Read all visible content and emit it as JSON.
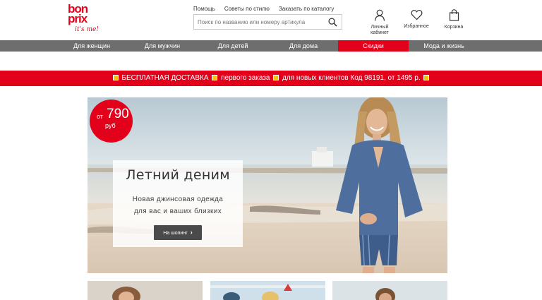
{
  "brand": {
    "logo_line1": "bon",
    "logo_line2": "prix",
    "tagline": "it's me!"
  },
  "top_links": [
    "Помощь",
    "Советы по стилю",
    "Заказать по каталогу"
  ],
  "search": {
    "placeholder": "Поиск по названию или номеру артикула",
    "icon": "search-icon"
  },
  "user_icons": [
    {
      "label_line1": "Личный",
      "label_line2": "кабинет",
      "icon": "user-icon"
    },
    {
      "label": "Избранное",
      "icon": "heart-icon"
    },
    {
      "label": "Корзина",
      "icon": "shopping-bag-icon"
    }
  ],
  "nav": [
    "Для женщин",
    "Для мужчин",
    "Для детей",
    "Для дома",
    "Скидки",
    "Мода и жизнь"
  ],
  "promo": {
    "part1": "БЕСПЛАТНАЯ ДОСТАВКА",
    "part2": "первого заказа",
    "part3": "для новых клиентов",
    "part4": "Код 98191, от 1495 р."
  },
  "hero": {
    "price_from": "от",
    "price_value": "790",
    "price_currency": "руб",
    "title": "Летний деним",
    "subtitle_line1": "Новая джинсовая одежда",
    "subtitle_line2": "для вас и ваших близких",
    "button": "На шопинг",
    "button_icon": "chevron-right-icon"
  },
  "colors": {
    "brand_red": "#e3001b",
    "nav_gray": "#6e6e6e",
    "button_dark": "#4a4a4a"
  }
}
